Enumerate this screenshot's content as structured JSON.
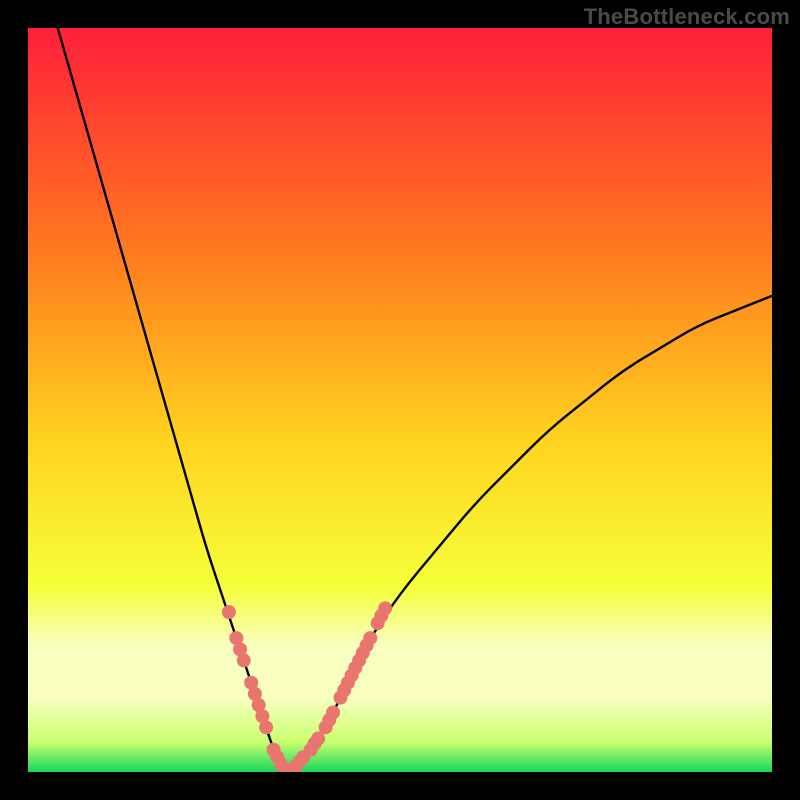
{
  "watermark": "TheBottleneck.com",
  "colors": {
    "frame": "#000000",
    "gradient_top": "#ff1f3a",
    "gradient_upper_mid": "#ff7a1f",
    "gradient_mid": "#ffd21f",
    "gradient_lower_mid": "#f6ff3a",
    "gradient_band": "#f8ffbf",
    "gradient_bottom": "#16d85b",
    "curve": "#000000",
    "dots": "#e9756f"
  },
  "chart_data": {
    "type": "line",
    "title": "",
    "xlabel": "",
    "ylabel": "",
    "xlim": [
      0,
      100
    ],
    "ylim": [
      0,
      100
    ],
    "series": [
      {
        "name": "bottleneck-curve",
        "x": [
          4,
          6,
          8,
          10,
          12,
          14,
          16,
          18,
          20,
          22,
          24,
          26,
          28,
          30,
          32,
          33,
          34,
          35,
          36,
          38,
          40,
          42,
          44,
          46,
          50,
          55,
          60,
          65,
          70,
          75,
          80,
          85,
          90,
          95,
          100
        ],
        "y": [
          100,
          93,
          86,
          79,
          72,
          65,
          58,
          51,
          44,
          37,
          30,
          24,
          18,
          12,
          6,
          3,
          1,
          0,
          1,
          3,
          6,
          10,
          14,
          18,
          24,
          30,
          36,
          41,
          46,
          50,
          54,
          57,
          60,
          62,
          64
        ]
      }
    ],
    "scatter": [
      {
        "name": "highlight-dots",
        "points": [
          [
            27,
            21.5
          ],
          [
            28,
            18
          ],
          [
            28.5,
            16.5
          ],
          [
            29,
            15
          ],
          [
            30,
            12
          ],
          [
            30.5,
            10.5
          ],
          [
            31,
            9
          ],
          [
            31.5,
            7.5
          ],
          [
            32,
            6
          ],
          [
            33,
            3
          ],
          [
            33.5,
            2
          ],
          [
            34,
            1
          ],
          [
            34.5,
            0.5
          ],
          [
            35,
            0
          ],
          [
            35.5,
            0.3
          ],
          [
            36,
            0.8
          ],
          [
            36.5,
            1.4
          ],
          [
            37,
            2
          ],
          [
            38,
            3
          ],
          [
            38.5,
            3.8
          ],
          [
            39,
            4.5
          ],
          [
            40,
            6
          ],
          [
            40.5,
            7
          ],
          [
            41,
            8
          ],
          [
            42,
            10
          ],
          [
            42.5,
            11
          ],
          [
            43,
            12
          ],
          [
            43.5,
            13
          ],
          [
            44,
            14
          ],
          [
            44.5,
            15
          ],
          [
            45,
            16
          ],
          [
            45.5,
            17
          ],
          [
            46,
            18
          ],
          [
            47,
            20
          ],
          [
            47.5,
            21
          ],
          [
            48,
            22
          ]
        ]
      }
    ]
  }
}
